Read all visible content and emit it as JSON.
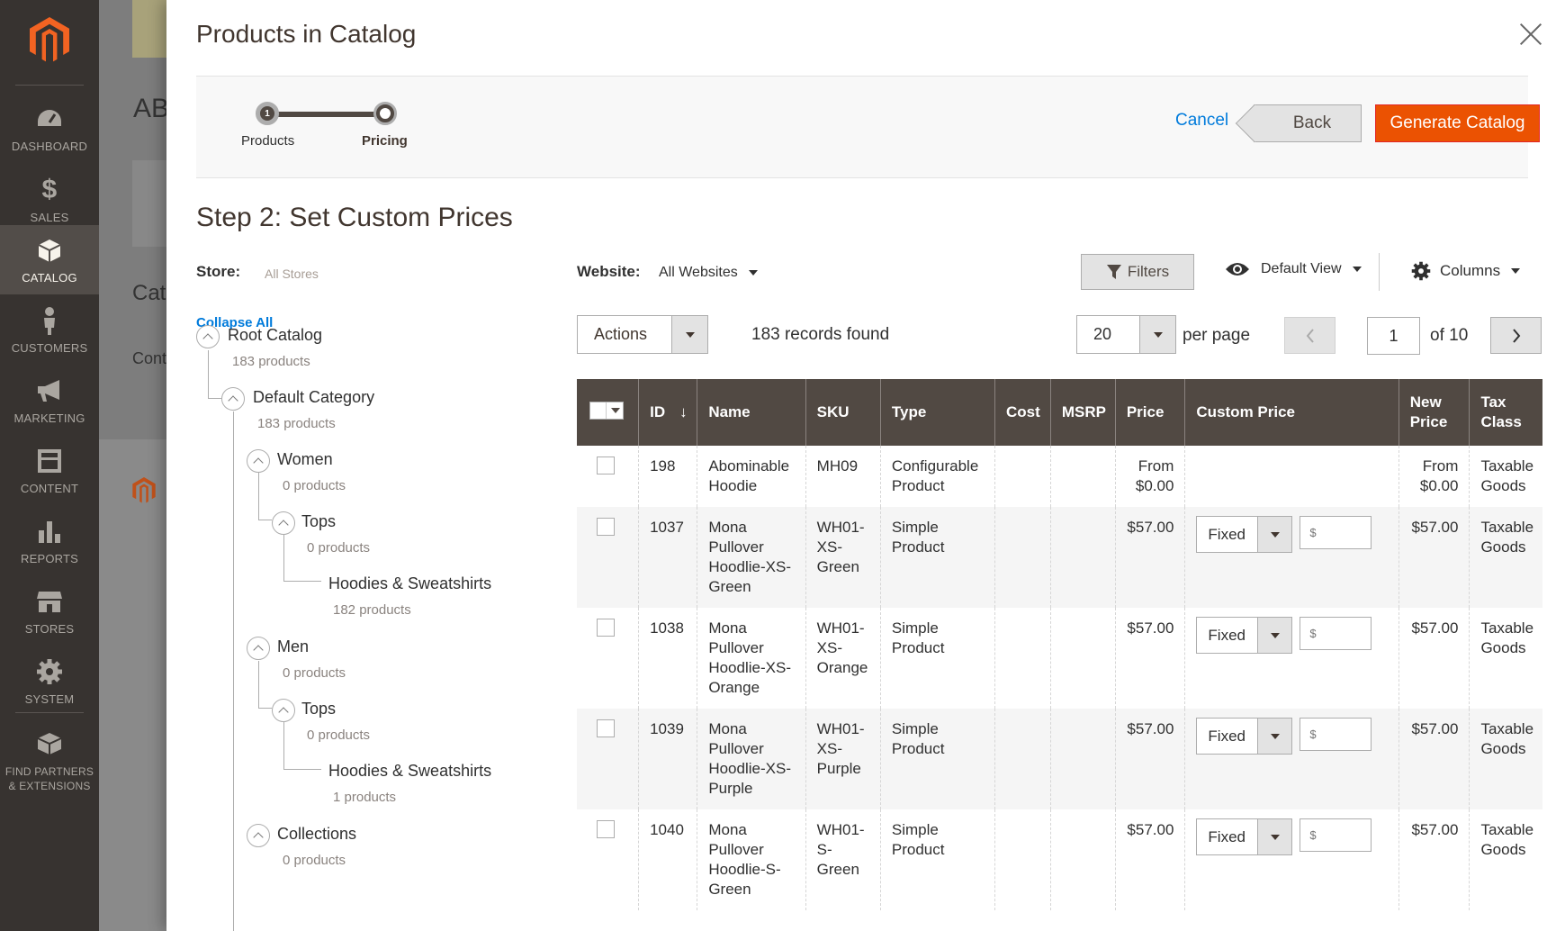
{
  "sidebar": {
    "logo": "magento-logo",
    "items": [
      {
        "label": "DASHBOARD",
        "icon": "dashboard-icon"
      },
      {
        "label": "SALES",
        "icon": "dollar-icon"
      },
      {
        "label": "CATALOG",
        "icon": "box-icon",
        "active": true
      },
      {
        "label": "CUSTOMERS",
        "icon": "person-icon"
      },
      {
        "label": "MARKETING",
        "icon": "megaphone-icon"
      },
      {
        "label": "CONTENT",
        "icon": "content-icon"
      },
      {
        "label": "REPORTS",
        "icon": "bar-chart-icon"
      },
      {
        "label": "STORES",
        "icon": "store-icon"
      },
      {
        "label": "SYSTEM",
        "icon": "gear-icon"
      },
      {
        "label": "FIND PARTNERS & EXTENSIONS",
        "icon": "partners-icon"
      }
    ]
  },
  "backdrop": {
    "heading_fragment": "AB",
    "subheading_fragment": "Cat",
    "text_fragment": "Cont"
  },
  "modal": {
    "title": "Products in Catalog",
    "wizard": {
      "steps": [
        "Products",
        "Pricing"
      ],
      "current_step": 2,
      "step_one_number": "1",
      "cancel_label": "Cancel",
      "back_label": "Back",
      "generate_label": "Generate Catalog"
    },
    "step_heading": "Step 2: Set Custom Prices",
    "store": {
      "label": "Store:",
      "value": "All Stores"
    },
    "collapse_all": "Collapse All",
    "tree": {
      "root": {
        "name": "Root Catalog",
        "count": "183 products"
      },
      "default": {
        "name": "Default Category",
        "count": "183 products"
      },
      "women": {
        "name": "Women",
        "count": "0 products"
      },
      "women_tops": {
        "name": "Tops",
        "count": "0 products"
      },
      "women_hoodies": {
        "name": "Hoodies & Sweatshirts",
        "count": "182 products"
      },
      "men": {
        "name": "Men",
        "count": "0 products"
      },
      "men_tops": {
        "name": "Tops",
        "count": "0 products"
      },
      "men_hoodies": {
        "name": "Hoodies & Sweatshirts",
        "count": "1 products"
      },
      "collections": {
        "name": "Collections",
        "count": "0 products"
      }
    },
    "grid": {
      "website_label": "Website:",
      "website_value": "All Websites",
      "filters_label": "Filters",
      "view_label": "Default View",
      "columns_label": "Columns",
      "actions_label": "Actions",
      "records_found": "183 records found",
      "per_page_value": "20",
      "per_page_label": "per page",
      "current_page": "1",
      "of_pages": "of 10",
      "columns": {
        "id": "ID",
        "name": "Name",
        "sku": "SKU",
        "type": "Type",
        "cost": "Cost",
        "msrp": "MSRP",
        "price": "Price",
        "custom_price": "Custom Price",
        "new_price_1": "New",
        "new_price_2": "Price",
        "tax_class_1": "Tax",
        "tax_class_2": "Class"
      },
      "price_type_value": "Fixed",
      "price_input_placeholder": "$",
      "rows": [
        {
          "id": "198",
          "name": [
            "Abominable",
            "Hoodie"
          ],
          "sku": [
            "MH09"
          ],
          "type": [
            "Configurable",
            "Product"
          ],
          "price": [
            "From",
            "$0.00"
          ],
          "new_price": [
            "From",
            "$0.00"
          ],
          "tax": [
            "Taxable",
            "Goods"
          ],
          "has_custom": false
        },
        {
          "id": "1037",
          "name": [
            "Mona",
            "Pullover",
            "Hoodlie-XS-",
            "Green"
          ],
          "sku": [
            "WH01-",
            "XS-",
            "Green"
          ],
          "type": [
            "Simple",
            "Product"
          ],
          "price": [
            "$57.00"
          ],
          "new_price": [
            "$57.00"
          ],
          "tax": [
            "Taxable",
            "Goods"
          ],
          "has_custom": true
        },
        {
          "id": "1038",
          "name": [
            "Mona",
            "Pullover",
            "Hoodlie-XS-",
            "Orange"
          ],
          "sku": [
            "WH01-",
            "XS-",
            "Orange"
          ],
          "type": [
            "Simple",
            "Product"
          ],
          "price": [
            "$57.00"
          ],
          "new_price": [
            "$57.00"
          ],
          "tax": [
            "Taxable",
            "Goods"
          ],
          "has_custom": true
        },
        {
          "id": "1039",
          "name": [
            "Mona",
            "Pullover",
            "Hoodlie-XS-",
            "Purple"
          ],
          "sku": [
            "WH01-",
            "XS-",
            "Purple"
          ],
          "type": [
            "Simple",
            "Product"
          ],
          "price": [
            "$57.00"
          ],
          "new_price": [
            "$57.00"
          ],
          "tax": [
            "Taxable",
            "Goods"
          ],
          "has_custom": true
        },
        {
          "id": "1040",
          "name": [
            "Mona",
            "Pullover",
            "Hoodlie-S-",
            "Green"
          ],
          "sku": [
            "WH01-",
            "S-",
            "Green"
          ],
          "type": [
            "Simple",
            "Product"
          ],
          "price": [
            "$57.00"
          ],
          "new_price": [
            "$57.00"
          ],
          "tax": [
            "Taxable",
            "Goods"
          ],
          "has_custom": true
        }
      ]
    }
  },
  "colors": {
    "sidebar_bg": "#373330",
    "sidebar_active": "#524d49",
    "primary_button": "#eb5202",
    "link": "#007bdb",
    "table_header": "#514943"
  }
}
